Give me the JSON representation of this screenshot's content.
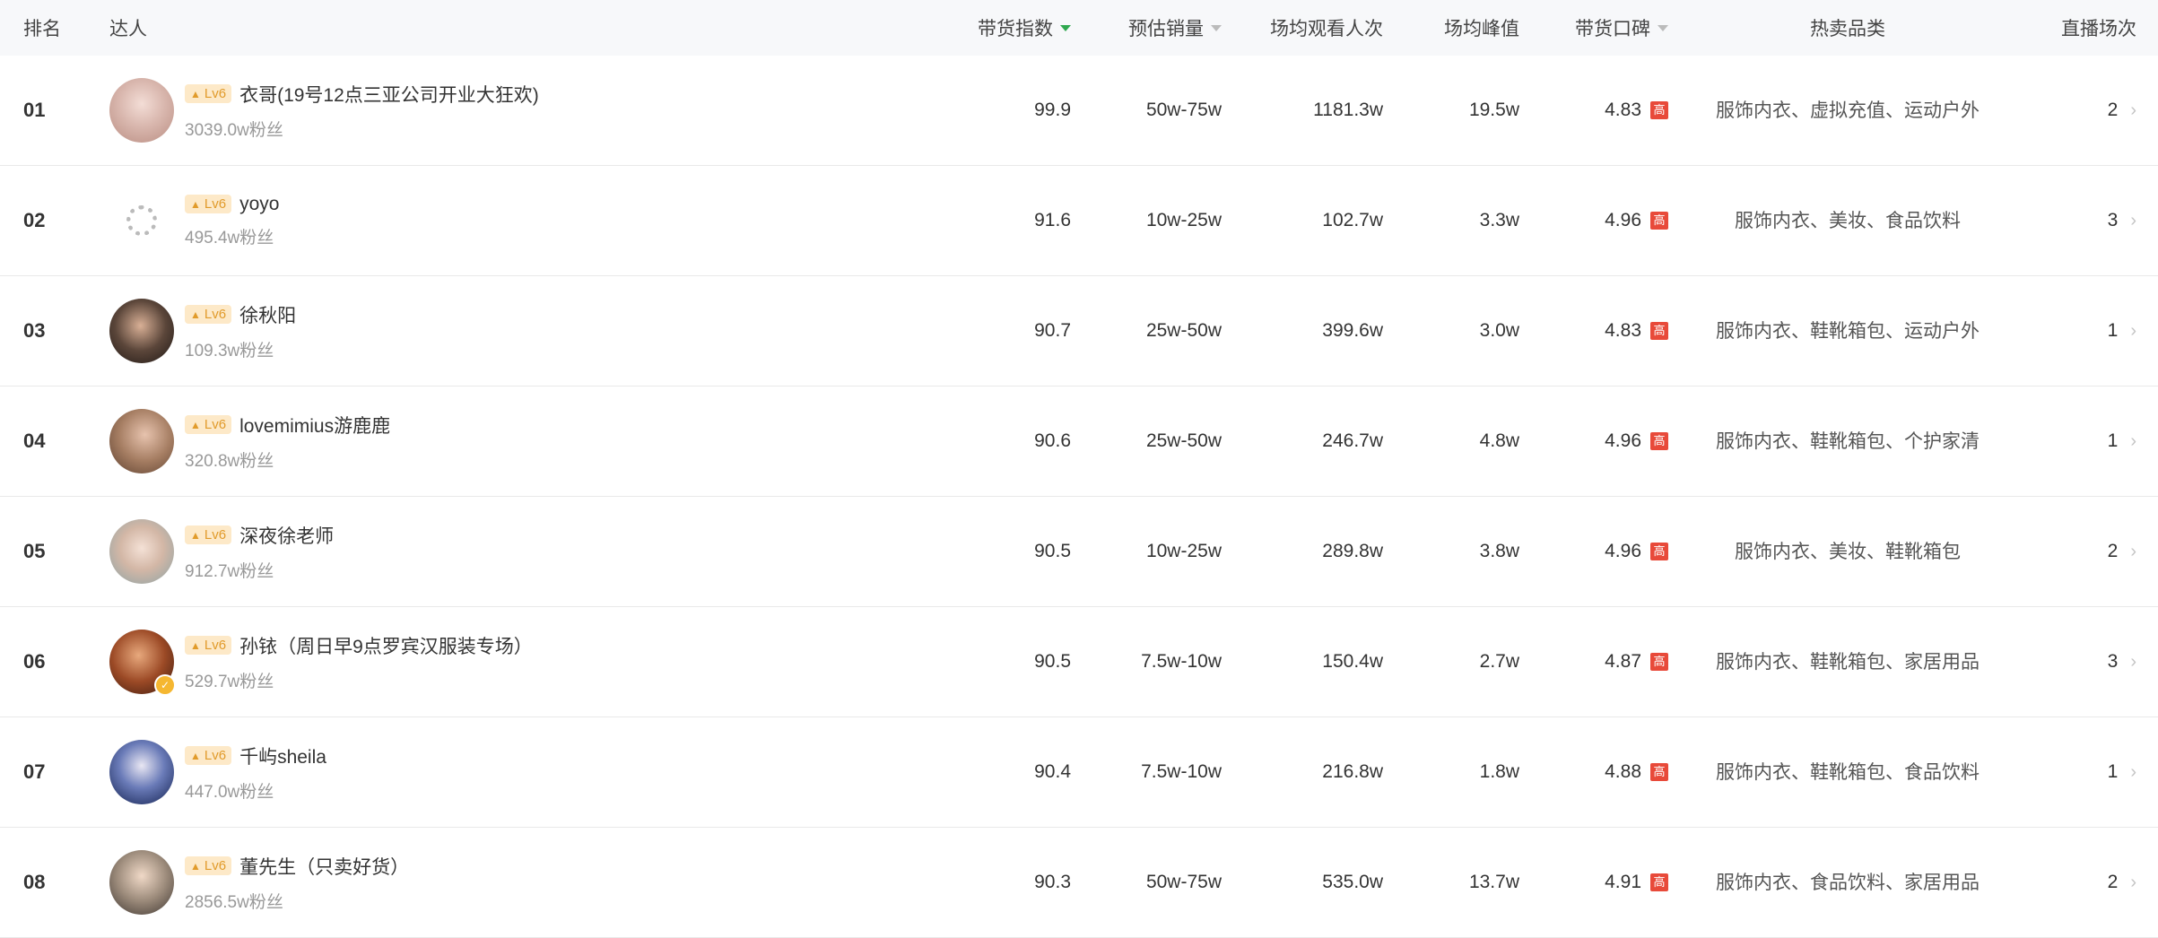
{
  "header": {
    "rank": "排名",
    "talent": "达人",
    "index": "带货指数",
    "sales": "预估销量",
    "views": "场均观看人次",
    "peak": "场均峰值",
    "rating": "带货口碑",
    "category": "热卖品类",
    "count": "直播场次"
  },
  "colors": {
    "accent": "#2fa84f",
    "level_bg": "#fde9c8",
    "level_text": "#e19b2b",
    "badge_red": "#e84a3a"
  },
  "rows": [
    {
      "rank": "01",
      "level": "Lv6",
      "name": "衣哥(19号12点三亚公司开业大狂欢)",
      "fans": "3039.0w粉丝",
      "index": "99.9",
      "sales": "50w-75w",
      "views": "1181.3w",
      "peak": "19.5w",
      "rating": "4.83",
      "badge": "高",
      "categories": "服饰内衣、虚拟充值、运动户外",
      "count": "2"
    },
    {
      "rank": "02",
      "level": "Lv6",
      "name": "yoyo",
      "fans": "495.4w粉丝",
      "index": "91.6",
      "sales": "10w-25w",
      "views": "102.7w",
      "peak": "3.3w",
      "rating": "4.96",
      "badge": "高",
      "categories": "服饰内衣、美妆、食品饮料",
      "count": "3"
    },
    {
      "rank": "03",
      "level": "Lv6",
      "name": "徐秋阳",
      "fans": "109.3w粉丝",
      "index": "90.7",
      "sales": "25w-50w",
      "views": "399.6w",
      "peak": "3.0w",
      "rating": "4.83",
      "badge": "高",
      "categories": "服饰内衣、鞋靴箱包、运动户外",
      "count": "1"
    },
    {
      "rank": "04",
      "level": "Lv6",
      "name": "lovemimius游鹿鹿",
      "fans": "320.8w粉丝",
      "index": "90.6",
      "sales": "25w-50w",
      "views": "246.7w",
      "peak": "4.8w",
      "rating": "4.96",
      "badge": "高",
      "categories": "服饰内衣、鞋靴箱包、个护家清",
      "count": "1"
    },
    {
      "rank": "05",
      "level": "Lv6",
      "name": "深夜徐老师",
      "fans": "912.7w粉丝",
      "index": "90.5",
      "sales": "10w-25w",
      "views": "289.8w",
      "peak": "3.8w",
      "rating": "4.96",
      "badge": "高",
      "categories": "服饰内衣、美妆、鞋靴箱包",
      "count": "2"
    },
    {
      "rank": "06",
      "level": "Lv6",
      "name": "孙铱（周日早9点罗宾汉服装专场）",
      "fans": "529.7w粉丝",
      "index": "90.5",
      "sales": "7.5w-10w",
      "views": "150.4w",
      "peak": "2.7w",
      "rating": "4.87",
      "badge": "高",
      "categories": "服饰内衣、鞋靴箱包、家居用品",
      "count": "3"
    },
    {
      "rank": "07",
      "level": "Lv6",
      "name": "千屿sheila",
      "fans": "447.0w粉丝",
      "index": "90.4",
      "sales": "7.5w-10w",
      "views": "216.8w",
      "peak": "1.8w",
      "rating": "4.88",
      "badge": "高",
      "categories": "服饰内衣、鞋靴箱包、食品饮料",
      "count": "1"
    },
    {
      "rank": "08",
      "level": "Lv6",
      "name": "董先生（只卖好货）",
      "fans": "2856.5w粉丝",
      "index": "90.3",
      "sales": "50w-75w",
      "views": "535.0w",
      "peak": "13.7w",
      "rating": "4.91",
      "badge": "高",
      "categories": "服饰内衣、食品饮料、家居用品",
      "count": "2"
    }
  ]
}
